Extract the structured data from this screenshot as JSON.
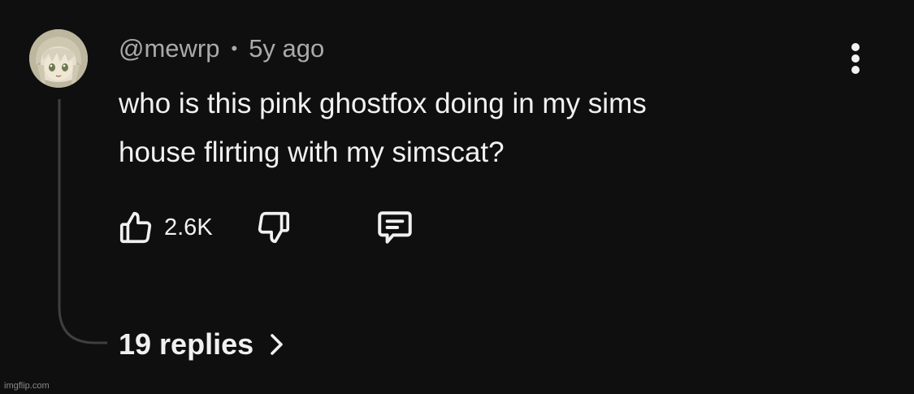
{
  "comment": {
    "author": "@mewrp",
    "separator": "•",
    "age": "5y ago",
    "text_line1": "who is this pink ghostfox doing in my sims",
    "text_line2": "house flirting with my simscat?",
    "like_count": "2.6K",
    "replies_label": "19 replies"
  },
  "icons": {
    "avatar": "anime-character-avatar",
    "menu": "more-vertical-icon",
    "like": "thumbs-up-icon",
    "dislike": "thumbs-down-icon",
    "reply": "comment-bubble-icon",
    "replies_arrow": "chevron-right-icon"
  },
  "colors": {
    "background": "#0f0f0f",
    "primary_text": "#f1f1f1",
    "secondary_text": "#aaaaaa",
    "thread_line": "#3f3f3f"
  },
  "watermark": "imgflip.com"
}
